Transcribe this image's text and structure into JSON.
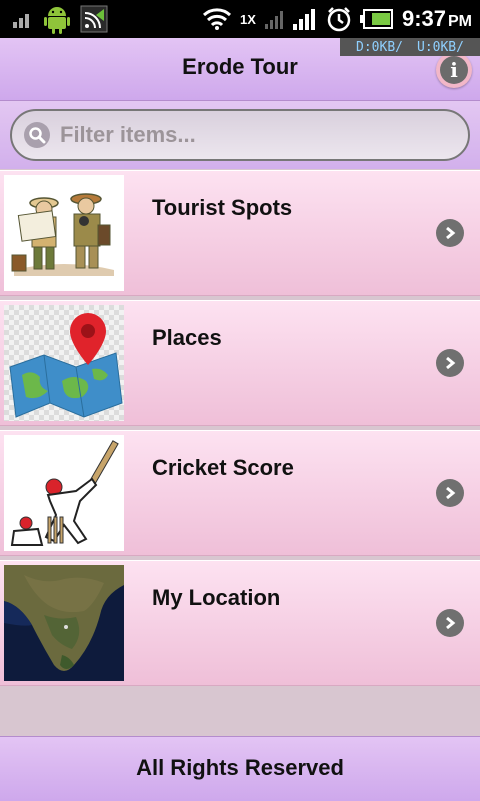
{
  "status_bar": {
    "time": "9:37",
    "ampm": "PM",
    "net_type": "1X",
    "download": "D:0KB/",
    "upload": "U:0KB/"
  },
  "header": {
    "title": "Erode Tour",
    "info_icon": "info-icon"
  },
  "search": {
    "placeholder": "Filter items..."
  },
  "list": {
    "items": [
      {
        "label": "Tourist Spots",
        "thumb": "tourists-illustration"
      },
      {
        "label": "Places",
        "thumb": "map-pin-illustration"
      },
      {
        "label": "Cricket Score",
        "thumb": "cricket-illustration"
      },
      {
        "label": "My Location",
        "thumb": "satellite-map"
      }
    ]
  },
  "footer": {
    "text": "All Rights Reserved"
  },
  "colors": {
    "header_bg": "#cea8ec",
    "row_bg": "#f5cde3",
    "footer_bg": "#cea8ec"
  }
}
